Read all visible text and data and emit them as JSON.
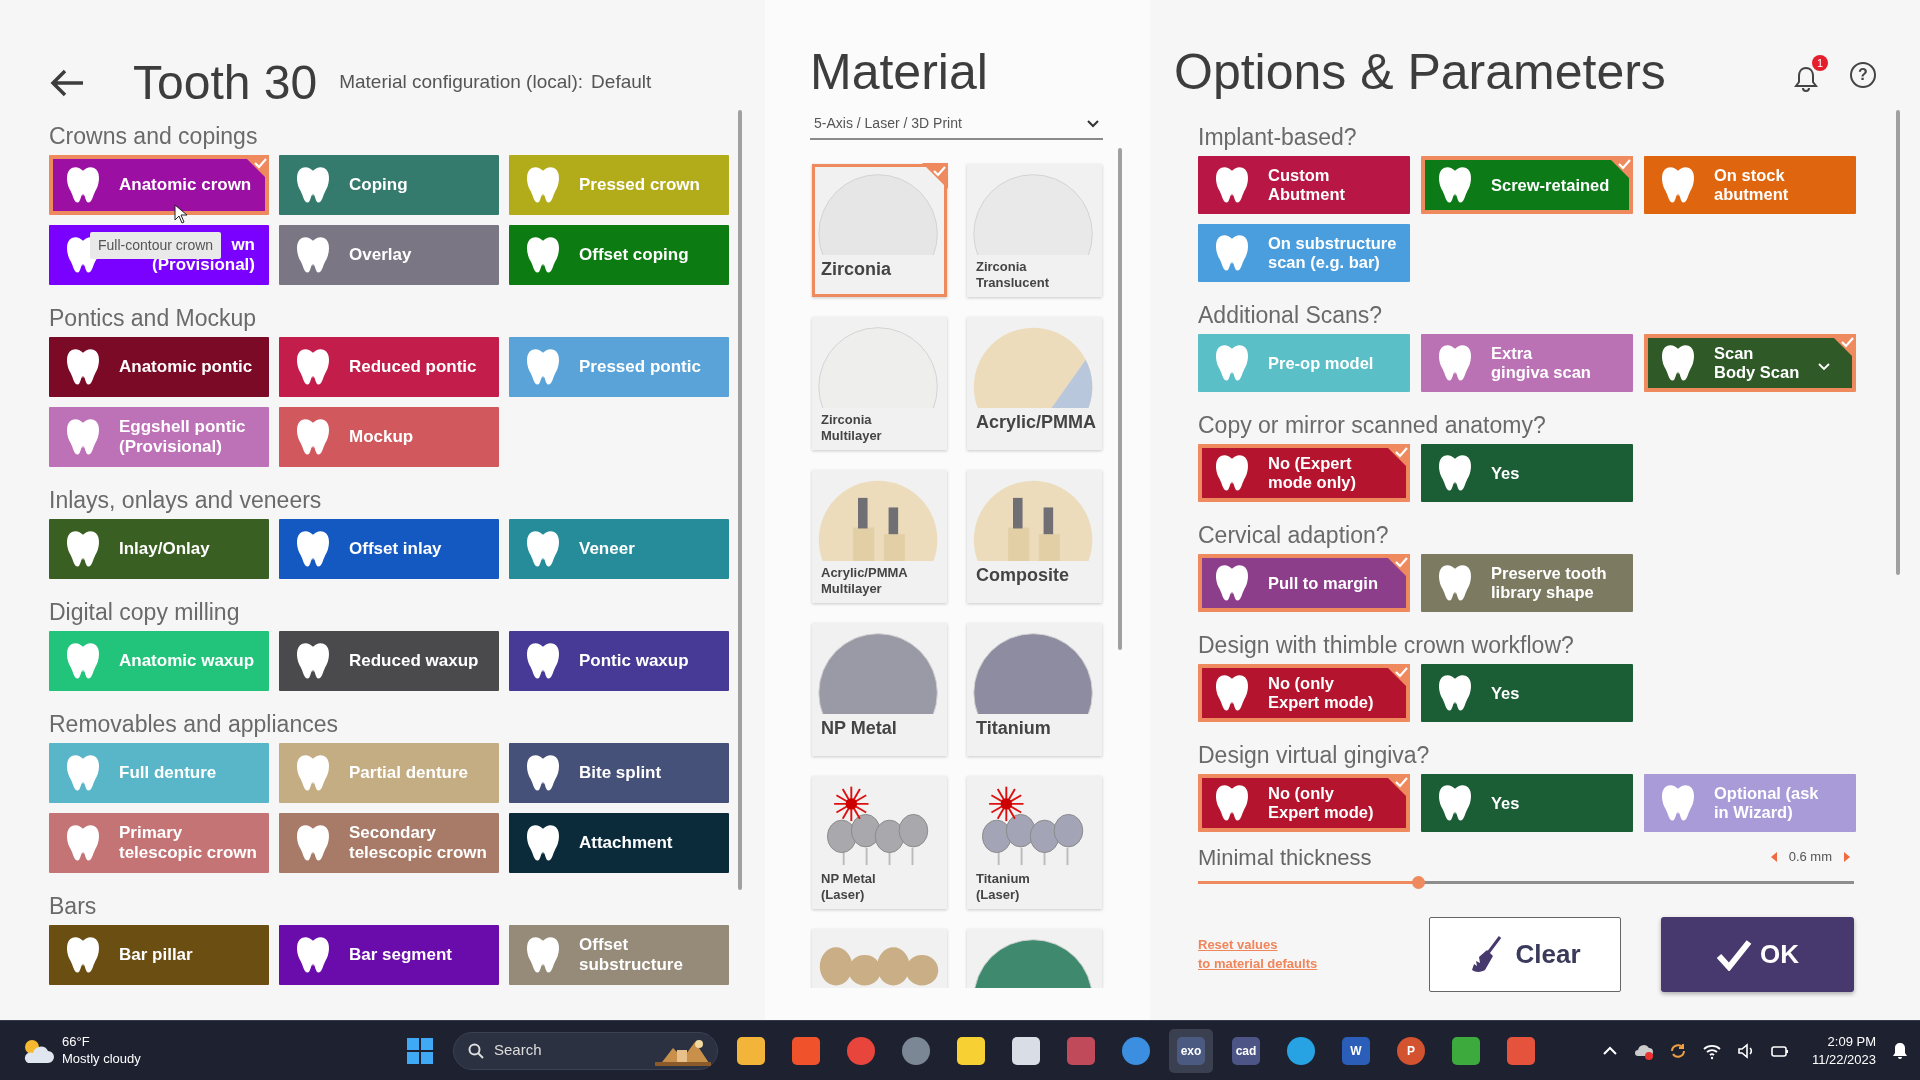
{
  "header": {
    "title": "Tooth 30",
    "subtitle": "Material configuration (local):",
    "config": "Default"
  },
  "sections": [
    {
      "title": "Crowns and copings",
      "items": [
        {
          "label": "Anatomic crown",
          "color": "#9c0fa3",
          "selected": true
        },
        {
          "label": "Coping",
          "color": "#347b6d",
          "selected": false
        },
        {
          "label": "Pressed crown",
          "color": "#b3ac1a",
          "selected": false
        },
        {
          "label": "wn\n(Provisional)",
          "color": "#7a00ff",
          "selected": false
        },
        {
          "label": "Overlay",
          "color": "#7a7683",
          "selected": false
        },
        {
          "label": "Offset coping",
          "color": "#0c7c12",
          "selected": false
        }
      ]
    },
    {
      "title": "Pontics and Mockup",
      "items": [
        {
          "label": "Anatomic pontic",
          "color": "#7a0a26",
          "selected": false
        },
        {
          "label": "Reduced pontic",
          "color": "#c21d4b",
          "selected": false
        },
        {
          "label": "Pressed pontic",
          "color": "#5aa3d9",
          "selected": false
        },
        {
          "label": "Eggshell pontic\n(Provisional)",
          "color": "#bd72b8",
          "selected": false
        },
        {
          "label": "Mockup",
          "color": "#d1585c",
          "selected": false
        }
      ]
    },
    {
      "title": "Inlays, onlays and veneers",
      "items": [
        {
          "label": "Inlay/Onlay",
          "color": "#3a5f22",
          "selected": false
        },
        {
          "label": "Offset inlay",
          "color": "#1458c1",
          "selected": false
        },
        {
          "label": "Veneer",
          "color": "#268c9a",
          "selected": false
        }
      ]
    },
    {
      "title": "Digital copy milling",
      "items": [
        {
          "label": "Anatomic waxup",
          "color": "#22c37a",
          "selected": false
        },
        {
          "label": "Reduced waxup",
          "color": "#4a4a4c",
          "selected": false
        },
        {
          "label": "Pontic waxup",
          "color": "#473a96",
          "selected": false
        }
      ]
    },
    {
      "title": "Removables and appliances",
      "items": [
        {
          "label": "Full denture",
          "color": "#58b6c8",
          "selected": false
        },
        {
          "label": "Partial denture",
          "color": "#c4ad83",
          "selected": false
        },
        {
          "label": "Bite splint",
          "color": "#465179",
          "selected": false
        },
        {
          "label": "Primary\ntelescopic crown",
          "color": "#c57476",
          "selected": false
        },
        {
          "label": "Secondary\ntelescopic crown",
          "color": "#a87a68",
          "selected": false
        },
        {
          "label": "Attachment",
          "color": "#0b2b3a",
          "selected": false
        }
      ]
    },
    {
      "title": "Bars",
      "items": [
        {
          "label": "Bar pillar",
          "color": "#6b4f12",
          "selected": false
        },
        {
          "label": "Bar segment",
          "color": "#6a0bab",
          "selected": false
        },
        {
          "label": "Offset\nsubstructure",
          "color": "#968a79",
          "selected": false
        }
      ]
    }
  ],
  "tooltip": "Full-contour crown",
  "material": {
    "title": "Material",
    "filter": "5-Axis / Laser / 3D Print",
    "tiles": [
      {
        "label": "Zirconia",
        "kind": "disc",
        "color": "#e6e6e6",
        "selected": true
      },
      {
        "label": "Zirconia\nTranslucent",
        "kind": "disc",
        "color": "#e9e9e9",
        "selected": false
      },
      {
        "label": "Zirconia\nMultilayer",
        "kind": "disc",
        "color": "#eeeeec",
        "selected": false
      },
      {
        "label": "Acrylic/PMMA",
        "kind": "split",
        "color": "#ecdcbc",
        "selected": false
      },
      {
        "label": "Acrylic/PMMA\nMultilayer",
        "kind": "blocks",
        "color": "#ecdcbc",
        "selected": false
      },
      {
        "label": "Composite",
        "kind": "blocks",
        "color": "#ecdcbc",
        "selected": false
      },
      {
        "label": "NP Metal",
        "kind": "disc",
        "color": "#9a99a6",
        "selected": false
      },
      {
        "label": "Titanium",
        "kind": "disc",
        "color": "#8d8ca0",
        "selected": false
      },
      {
        "label": "NP Metal\n(Laser)",
        "kind": "laser",
        "color": "#a9a9ad",
        "selected": false
      },
      {
        "label": "Titanium\n(Laser)",
        "kind": "laser",
        "color": "#a3a4b5",
        "selected": false
      },
      {
        "kind": "teeth",
        "color": "#c9ae86",
        "selected": false
      },
      {
        "kind": "disc",
        "color": "#3f8a6e",
        "selected": false
      }
    ]
  },
  "options": {
    "title": "Options & Parameters",
    "notifications": "1",
    "help": "?",
    "groups": [
      {
        "title": "Implant-based?",
        "items": [
          {
            "label": "Custom\nAbutment",
            "color": "#b81745",
            "selected": false
          },
          {
            "label": "Screw-retained",
            "color": "#0b7a17",
            "selected": true
          },
          {
            "label": "On stock\nabutment",
            "color": "#e0650f",
            "selected": false
          },
          {
            "label": "On substructure\nscan (e.g. bar)",
            "color": "#4b9ede",
            "selected": false
          }
        ]
      },
      {
        "title": "Additional Scans?",
        "items": [
          {
            "label": "Pre-op model",
            "color": "#5bbfc7",
            "selected": false
          },
          {
            "label": "Extra\ngingiva scan",
            "color": "#bb72b5",
            "selected": false
          },
          {
            "label": "Scan\nBody Scan",
            "color": "#2f5a28",
            "selected": true,
            "dropdown": true
          }
        ]
      },
      {
        "title": "Copy or mirror scanned anatomy?",
        "items": [
          {
            "label": "No (Expert\nmode only)",
            "color": "#b5142e",
            "selected": true
          },
          {
            "label": "Yes",
            "color": "#1b5e35",
            "selected": false
          }
        ]
      },
      {
        "title": "Cervical adaption?",
        "items": [
          {
            "label": "Pull to margin",
            "color": "#8c3e8a",
            "selected": true
          },
          {
            "label": "Preserve tooth\nlibrary shape",
            "color": "#7d7a62",
            "selected": false
          }
        ]
      },
      {
        "title": "Design with thimble crown workflow?",
        "items": [
          {
            "label": "No (only\nExpert mode)",
            "color": "#b5142e",
            "selected": true
          },
          {
            "label": "Yes",
            "color": "#1b5e35",
            "selected": false
          }
        ]
      },
      {
        "title": "Design virtual gingiva?",
        "items": [
          {
            "label": "No (only\nExpert mode)",
            "color": "#b5142e",
            "selected": true
          },
          {
            "label": "Yes",
            "color": "#1b5e35",
            "selected": false
          },
          {
            "label": "Optional (ask\nin Wizard)",
            "color": "#a99ad8",
            "selected": false
          }
        ]
      }
    ],
    "thickness": {
      "label": "Minimal thickness",
      "reading": "0.6 mm",
      "level": 0.335
    },
    "reset": "Reset values\nto material defaults",
    "clear": "Clear",
    "ok": "OK"
  },
  "taskbar": {
    "temperature": "66°F",
    "weather": "Mostly cloudy",
    "search": "Search",
    "apps": [
      {
        "kind": "square",
        "color": "#f2b53a",
        "active": false
      },
      {
        "kind": "square",
        "color": "#f0532b",
        "active": false
      },
      {
        "kind": "round",
        "color": "#e8453c",
        "active": false
      },
      {
        "kind": "round",
        "color": "#7b8794",
        "active": false
      },
      {
        "kind": "square",
        "color": "#f7d133",
        "active": false
      },
      {
        "kind": "square",
        "color": "#d8dde6",
        "active": false
      },
      {
        "kind": "square",
        "color": "#c04a5a",
        "active": false
      },
      {
        "kind": "round",
        "color": "#3c8ee0",
        "active": false
      },
      {
        "kind": "square",
        "color": "#4a5a80",
        "label": "exo",
        "active": true
      },
      {
        "kind": "square",
        "color": "#4c5586",
        "label": "cad",
        "active": false
      },
      {
        "kind": "round",
        "color": "#27a3e3",
        "active": false
      },
      {
        "kind": "square",
        "color": "#2b5eb8",
        "label": "W",
        "active": false
      },
      {
        "kind": "round",
        "color": "#d35230",
        "label": "P",
        "active": false
      },
      {
        "kind": "square",
        "color": "#3caa3c",
        "active": false
      },
      {
        "kind": "square",
        "color": "#e5533d",
        "active": false
      }
    ],
    "time": "2:09 PM",
    "date": "11/22/2023"
  }
}
